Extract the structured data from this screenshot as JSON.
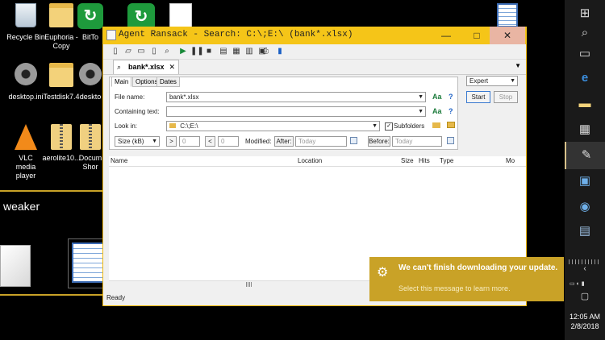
{
  "desktop": {
    "icons": [
      {
        "label": "Recycle Bin"
      },
      {
        "label": "Euphoria - Copy"
      },
      {
        "label": "BitTo"
      },
      {
        "label": "desktop.ini"
      },
      {
        "label": "Testdisk7.4"
      },
      {
        "label": "deskto"
      },
      {
        "label": "VLC media player"
      },
      {
        "label": "aerolite10..."
      },
      {
        "label": "Docum Shor"
      }
    ],
    "preview_title": "weaker"
  },
  "window": {
    "title": "Agent Ransack - Search: C:\\;E:\\ (bank*.xlsx)",
    "min": "—",
    "max": "□",
    "close": "✕",
    "doc_tab": "bank*.xlsx",
    "doc_tab_close": "✕",
    "panel_tabs": [
      "Main",
      "Options",
      "Dates"
    ],
    "file_name_label": "File name:",
    "file_name_value": "bank*.xlsx",
    "containing_label": "Containing text:",
    "containing_value": "",
    "look_in_label": "Look in:",
    "look_in_value": "C:\\;E:\\",
    "subfolders_label": "Subfolders",
    "size_select": "Size (kB)",
    "gt_btn": ">",
    "gt_value": "0",
    "lt_btn": "<",
    "lt_value": "0",
    "modified_label": "Modified:",
    "after_btn": "After:",
    "after_value": "Today",
    "before_btn": "Before:",
    "before_value": "Today",
    "mode_select": "Expert",
    "start_btn": "Start",
    "stop_btn": "Stop",
    "aa": "Aa",
    "help": "?",
    "columns": [
      "Name",
      "Location",
      "Size",
      "Hits",
      "Type",
      "Mo"
    ],
    "status": "Ready"
  },
  "toast": {
    "title": "We can't finish downloading your update.",
    "subtitle": "Select this message to learn more."
  },
  "taskbar": {
    "time": "12:05 AM",
    "date": "2/8/2018"
  }
}
